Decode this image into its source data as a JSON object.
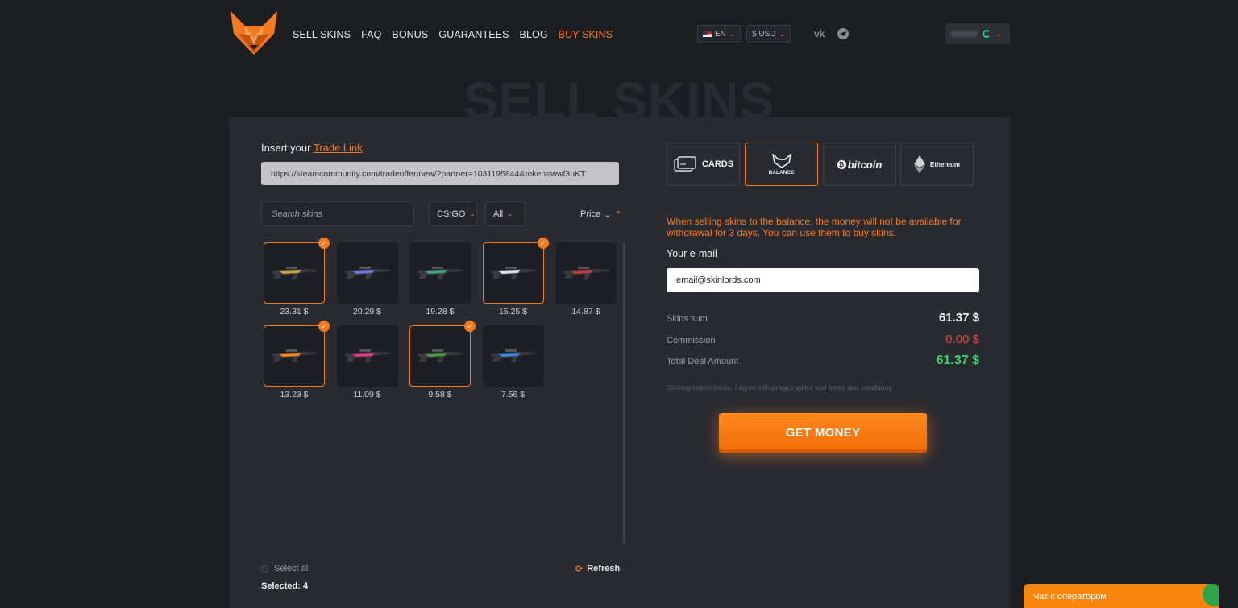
{
  "nav": {
    "items": [
      "SELL SKINS",
      "FAQ",
      "BONUS",
      "GUARANTEES",
      "BLOG",
      "BUY SKINS"
    ]
  },
  "header": {
    "language": "EN",
    "currency": "$ USD"
  },
  "page": {
    "bg_title": "SELL SKINS"
  },
  "trade": {
    "label_prefix": "Insert your",
    "label_link": "Trade Link",
    "value": "https://steamcommunity.com/tradeoffer/new/?partner=1031195844&token=wwf3uKT"
  },
  "filters": {
    "search_placeholder": "Search skins",
    "game": "CS:GO",
    "type": "All",
    "sort": "Price"
  },
  "skins": [
    {
      "price": "23.31 $",
      "selected": true,
      "color": "#c8a23a"
    },
    {
      "price": "20.29 $",
      "selected": false,
      "color": "#6b7ad8"
    },
    {
      "price": "19.28 $",
      "selected": false,
      "color": "#3ea67a"
    },
    {
      "price": "15.25 $",
      "selected": true,
      "color": "#e0e0e0"
    },
    {
      "price": "14.87 $",
      "selected": false,
      "color": "#c23a3a"
    },
    {
      "price": "13.23 $",
      "selected": true,
      "color": "#f08a20"
    },
    {
      "price": "11.09 $",
      "selected": false,
      "color": "#e03a8a"
    },
    {
      "price": "9.58 $",
      "selected": true,
      "color": "#4a9a4a"
    },
    {
      "price": "7.56 $",
      "selected": false,
      "color": "#3a8ad8"
    }
  ],
  "list_footer": {
    "select_all": "Select all",
    "refresh": "Refresh",
    "selected": "Selected: 4"
  },
  "payment": {
    "cards": "CARDS",
    "balance": "BALANCE",
    "bitcoin": "bitcoin",
    "ethereum": "Ethereum",
    "active": "balance"
  },
  "form": {
    "notice": "When selling skins to the balance, the money will not be available for withdrawal for 3 days. You can use them to buy skins.",
    "email_label": "Your e-mail",
    "email_value": "email@skinlords.com"
  },
  "summary": {
    "skins_sum_label": "Skins sum",
    "skins_sum": "61.37 $",
    "commission_label": "Commission",
    "commission": "0.00 $",
    "total_label": "Total Deal Amount",
    "total": "61.37 $"
  },
  "agree": {
    "prefix": "Clicking button below, I agree with",
    "privacy": "privacy policy",
    "and": "and",
    "terms": "terms and conditions"
  },
  "cta": {
    "label": "GET MONEY"
  },
  "chat": {
    "label": "Чат с оператором"
  },
  "colors": {
    "accent": "#f47a20",
    "background": "#1d1e22",
    "panel": "#2a2b31",
    "green": "#3fd06a",
    "red": "#e0483c"
  }
}
